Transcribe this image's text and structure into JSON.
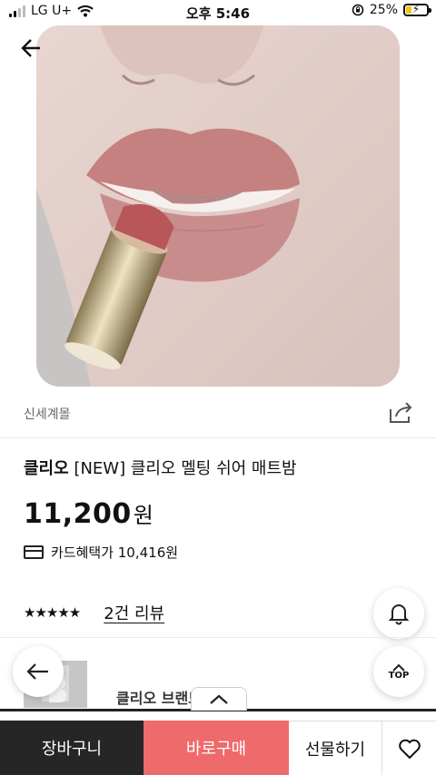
{
  "status_bar": {
    "carrier": "LG U+",
    "time": "오후 5:46",
    "battery_percent": "25%",
    "battery_level": 0.25,
    "icons": [
      "signal-icon",
      "wifi-icon",
      "orientation-lock-icon",
      "battery-icon"
    ]
  },
  "header": {
    "back_icon": "back-arrow-icon"
  },
  "product": {
    "brand": "신세계몰",
    "title_brand": "클리오",
    "title": "[NEW] 클리오 멜팅 쉬어 매트밤",
    "price": "11,200",
    "price_unit": "원",
    "card_benefit": "카드혜택가 10,416원",
    "stars": "★★★★★",
    "rating_stars": 5,
    "review_link": "2건 리뷰"
  },
  "related": {
    "text": "클리오 브랜드관"
  },
  "floating": {
    "top_label": "TOP"
  },
  "bottom_bar": {
    "cart": "장바구니",
    "buy": "바로구매",
    "gift": "선물하기"
  },
  "colors": {
    "buy_button": "#ef6a6a",
    "cart_button": "#262626",
    "accent_battery": "#f5c518"
  }
}
